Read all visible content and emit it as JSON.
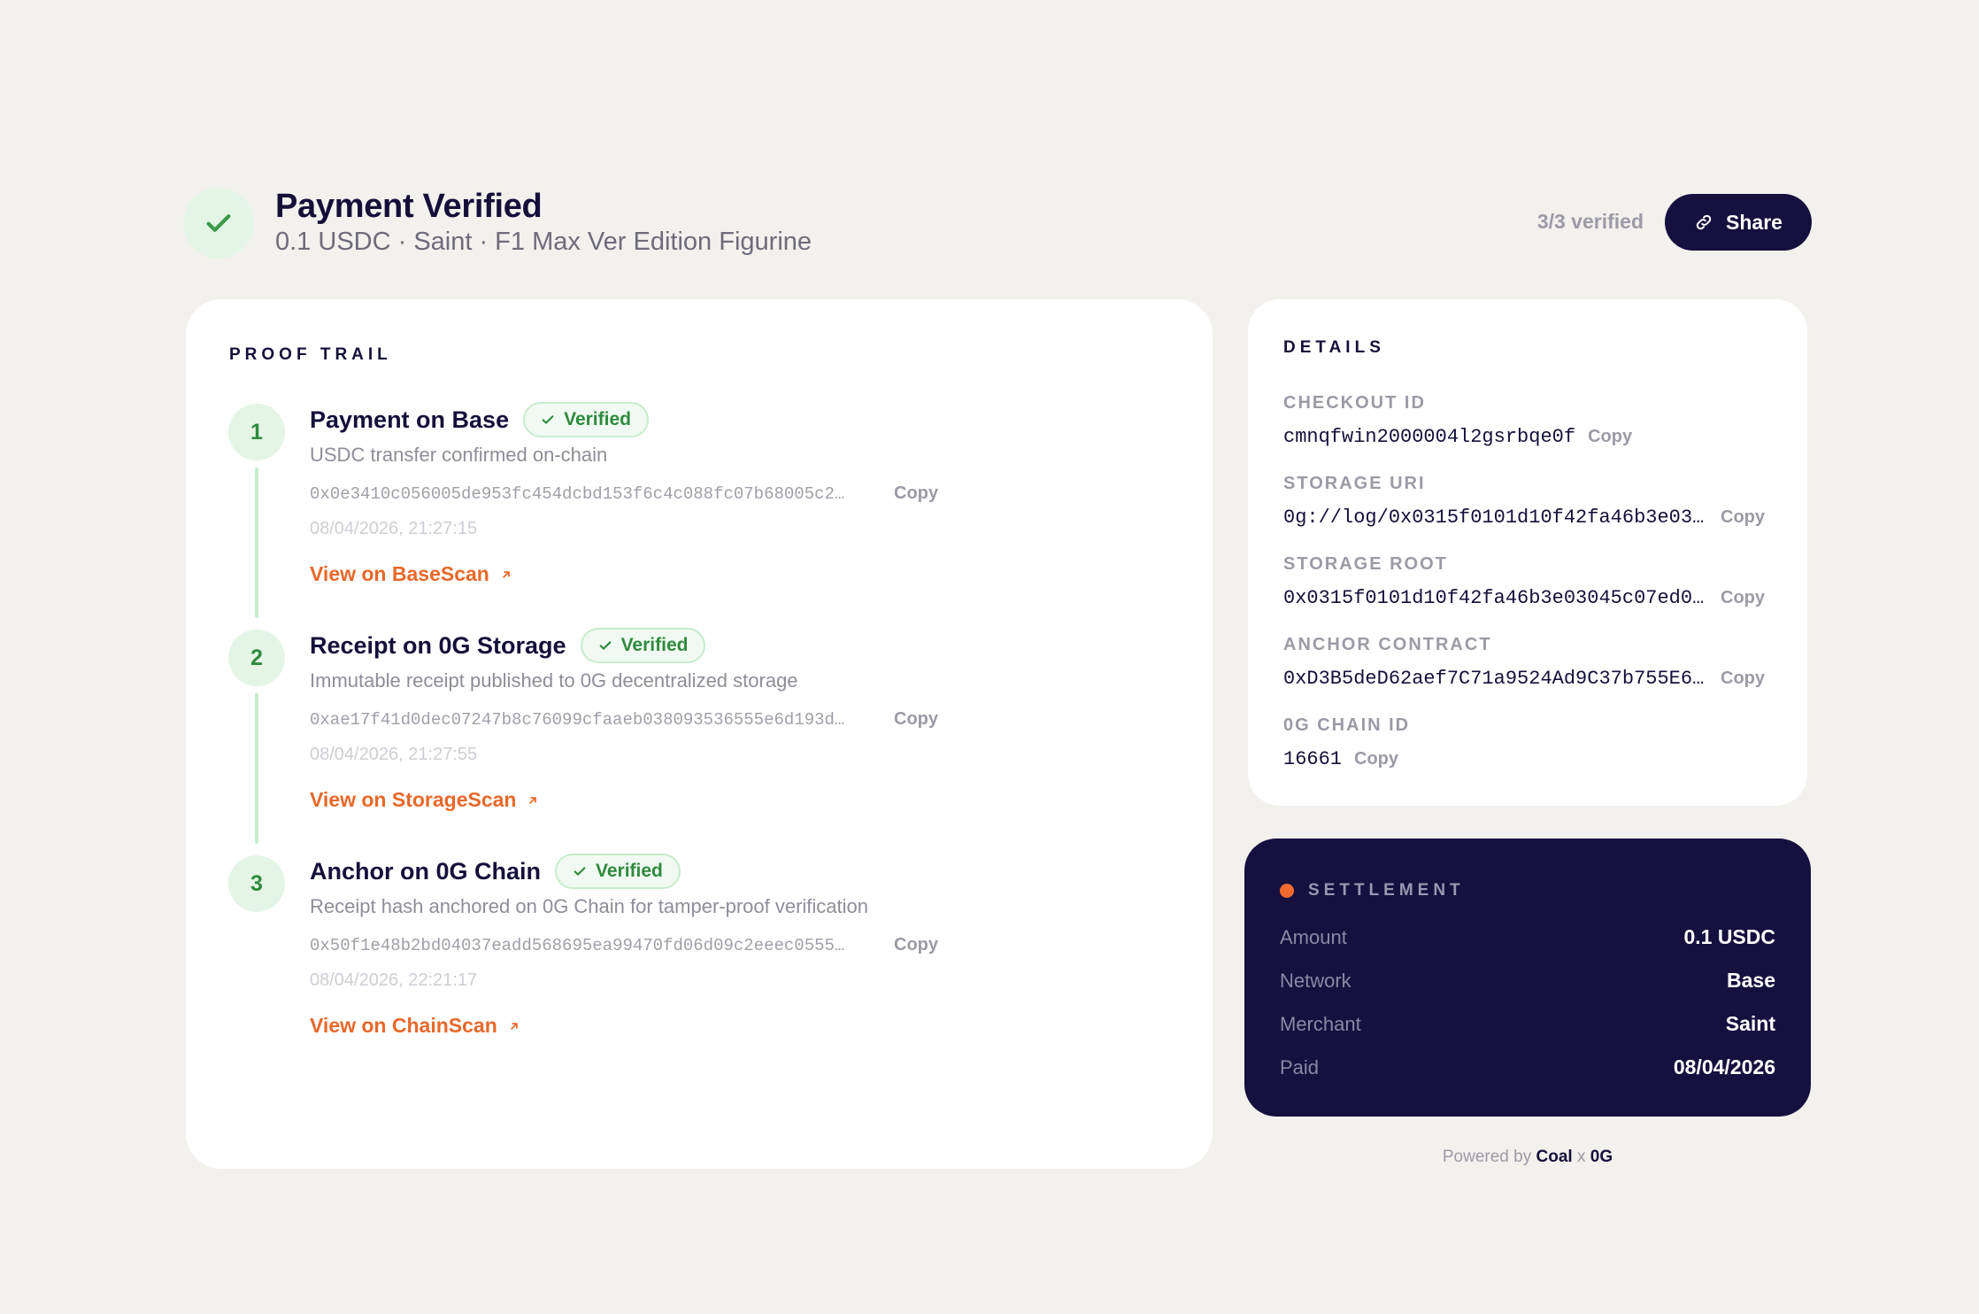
{
  "header": {
    "title": "Payment Verified",
    "subtitle": "0.1 USDC · Saint · F1 Max Ver Edition Figurine",
    "verified_count": "3/3 verified",
    "share_label": "Share"
  },
  "proof_trail": {
    "title": "PROOF TRAIL",
    "steps": [
      {
        "number": "1",
        "title": "Payment on Base",
        "badge": "Verified",
        "description": "USDC transfer confirmed on-chain",
        "hash": "0x0e3410c056005de953fc454dcbd153f6c4c088fc07b68005c2…",
        "copy": "Copy",
        "timestamp": "08/04/2026, 21:27:15",
        "link": "View on BaseScan"
      },
      {
        "number": "2",
        "title": "Receipt on 0G Storage",
        "badge": "Verified",
        "description": "Immutable receipt published to 0G decentralized storage",
        "hash": "0xae17f41d0dec07247b8c76099cfaaeb038093536555e6d193d…",
        "copy": "Copy",
        "timestamp": "08/04/2026, 21:27:55",
        "link": "View on StorageScan"
      },
      {
        "number": "3",
        "title": "Anchor on 0G Chain",
        "badge": "Verified",
        "description": "Receipt hash anchored on 0G Chain for tamper-proof verification",
        "hash": "0x50f1e48b2bd04037eadd568695ea99470fd06d09c2eeec0555…",
        "copy": "Copy",
        "timestamp": "08/04/2026, 22:21:17",
        "link": "View on ChainScan"
      }
    ]
  },
  "details": {
    "title": "DETAILS",
    "items": [
      {
        "label": "CHECKOUT ID",
        "value": "cmnqfwin2000004l2gsrbqe0f",
        "copy": "Copy"
      },
      {
        "label": "STORAGE URI",
        "value": "0g://log/0x0315f0101d10f42fa46b3e03…",
        "copy": "Copy"
      },
      {
        "label": "STORAGE ROOT",
        "value": "0x0315f0101d10f42fa46b3e03045c07ed0…",
        "copy": "Copy"
      },
      {
        "label": "ANCHOR CONTRACT",
        "value": "0xD3B5deD62aef7C71a9524Ad9C37b755E6…",
        "copy": "Copy"
      },
      {
        "label": "0G CHAIN ID",
        "value": "16661",
        "copy": "Copy"
      }
    ]
  },
  "settlement": {
    "title": "SETTLEMENT",
    "rows": [
      {
        "label": "Amount",
        "value": "0.1 USDC"
      },
      {
        "label": "Network",
        "value": "Base"
      },
      {
        "label": "Merchant",
        "value": "Saint"
      },
      {
        "label": "Paid",
        "value": "08/04/2026"
      }
    ]
  },
  "footer": {
    "prefix": "Powered by",
    "brand1": "Coal",
    "sep": "x",
    "brand2": "0G"
  },
  "colors": {
    "background": "#f3f1ed",
    "navy": "#16103f",
    "green": "#2f8a3e",
    "orange_link": "#e8682a",
    "settlement_dot": "#f06a2f"
  }
}
